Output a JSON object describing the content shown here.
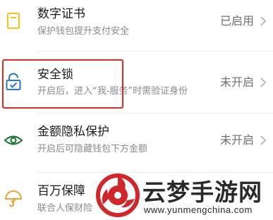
{
  "settings": {
    "items": [
      {
        "icon": "certificate-icon",
        "title": "数字证书",
        "subtitle": "保护钱包提升支付安全",
        "status": "已启用"
      },
      {
        "icon": "lock-icon",
        "title": "安全锁",
        "subtitle": "开启后，进入“我-服务”时需验证身份",
        "status": "未开启"
      },
      {
        "icon": "eye-icon",
        "title": "金额隐私保护",
        "subtitle": "开启后可隐藏钱包下方金额",
        "status": "未开启"
      },
      {
        "icon": "umbrella-icon",
        "title": "百万保障",
        "subtitle": "联合人保财险",
        "status": ""
      }
    ]
  },
  "colors": {
    "highlight": "#e02a25",
    "certificate_icon": "#f2c51a",
    "lock_icon": "#2a78c8",
    "eye_icon": "#1f7a3a",
    "umbrella_icon": "#e8a53a",
    "watermark_logo": "#d0282a"
  },
  "watermark": {
    "name": "云梦手游网",
    "url": "www.yunmengchina.com"
  }
}
